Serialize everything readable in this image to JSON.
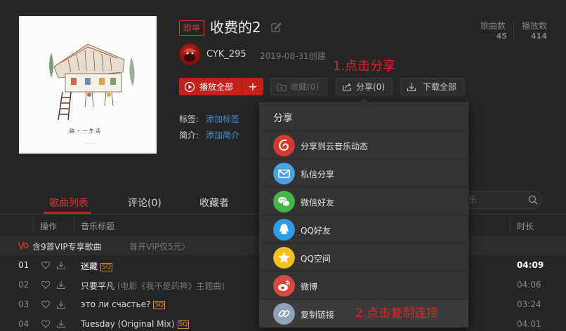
{
  "header": {
    "tag": "歌单",
    "title": "收费的2",
    "stats": [
      {
        "label": "歌曲数",
        "value": "45"
      },
      {
        "label": "播放数",
        "value": "414"
      }
    ],
    "creator": "CYK_295",
    "created": "2019-08-31创建",
    "annotation_share": "1.点击分享"
  },
  "actions": {
    "play_all": "播放全部",
    "add": "+",
    "collect": "收藏(0)",
    "share": "分享(0)",
    "download_all": "下载全部"
  },
  "meta": {
    "tags_label": "标签:",
    "tags_link": "添加标签",
    "intro_label": "简介:",
    "intro_link": "添加简介"
  },
  "tabs": [
    {
      "label": "歌曲列表",
      "active": true
    },
    {
      "label": "评论(0)",
      "active": false
    },
    {
      "label": "收藏者",
      "active": false
    }
  ],
  "search": {
    "placeholder": "乐"
  },
  "list_header": {
    "ops": "操作",
    "title": "音乐标题",
    "duration": "时长"
  },
  "vip_notice": {
    "text": "含9首VIP专享歌曲",
    "promo": "首开VIP仅5元"
  },
  "songs": [
    {
      "num": "01",
      "title": "迷藏",
      "sq": "SQ",
      "extra": "",
      "duration": "04:09"
    },
    {
      "num": "02",
      "title": "只要平凡",
      "sq": "",
      "extra": "(电影《我不是药神》主题曲)",
      "duration": "04:06"
    },
    {
      "num": "03",
      "title": "это ли счастье?",
      "sq": "SQ",
      "extra": "",
      "duration": "03:24"
    },
    {
      "num": "04",
      "title": "Tuesday (Original Mix)",
      "sq": "SQ",
      "extra": "",
      "duration": "04:01"
    }
  ],
  "share_popup": {
    "title": "分享",
    "items": [
      {
        "label": "分享到云音乐动态",
        "icon": "netease-cloud-icon",
        "color": "#d33a31"
      },
      {
        "label": "私信分享",
        "icon": "mail-icon",
        "color": "#4aa3e0"
      },
      {
        "label": "微信好友",
        "icon": "wechat-icon",
        "color": "#44b549"
      },
      {
        "label": "QQ好友",
        "icon": "qq-icon",
        "color": "#2f9ce8"
      },
      {
        "label": "QQ空间",
        "icon": "qzone-star-icon",
        "color": "#f2c21a"
      },
      {
        "label": "微博",
        "icon": "weibo-icon",
        "color": "#d84a3c"
      },
      {
        "label": "复制链接",
        "icon": "link-icon",
        "color": "#8fa3bd"
      }
    ],
    "annotation_copy": "2.点击复制连接"
  },
  "colors": {
    "accent": "#c3211b",
    "link": "#4a8fd6",
    "annotation": "#e0262b"
  }
}
